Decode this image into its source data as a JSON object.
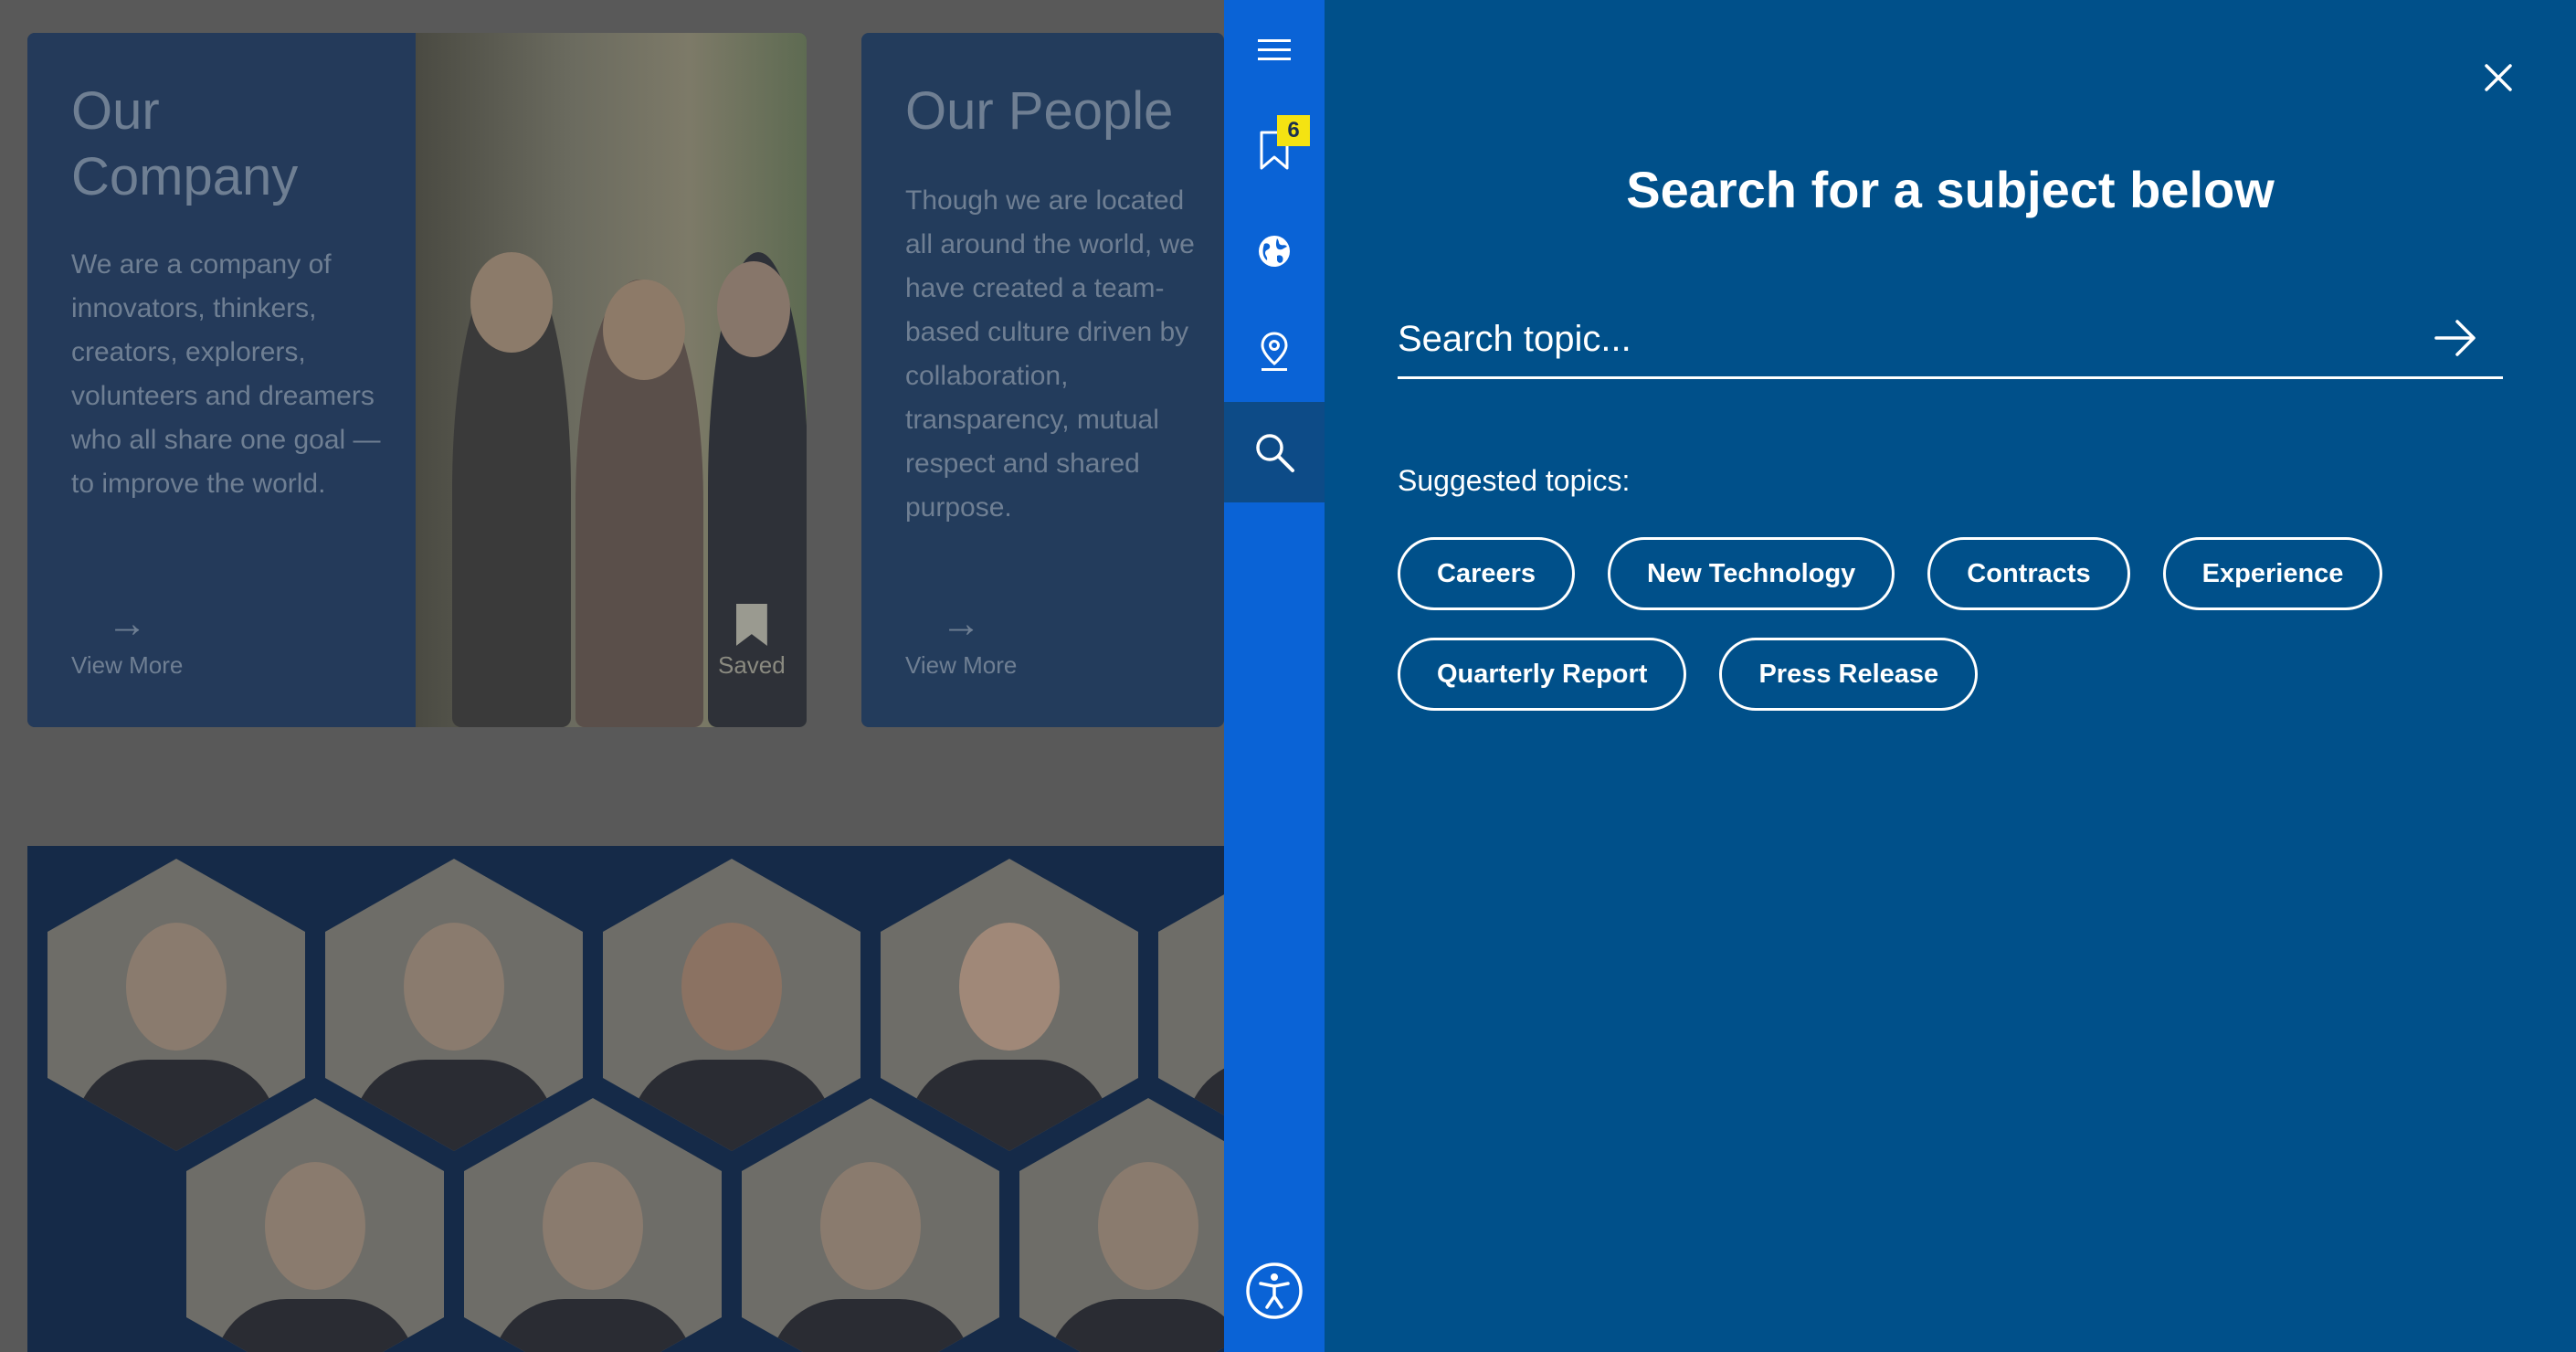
{
  "background": {
    "company_card": {
      "title": "Our Company",
      "text": "We are a company of innovators, thinkers, creators, explorers, volunteers and dreamers who all share one goal — to improve the world.",
      "link_label": "View More",
      "saved_label": "Saved"
    },
    "people_card": {
      "title": "Our People",
      "text": "Though we are located all around the world, we have created a team-based culture driven by collaboration, transparency, mutual respect and shared purpose.",
      "link_label": "View More"
    }
  },
  "sidebar": {
    "items": [
      {
        "icon": "hamburger-menu-icon"
      },
      {
        "icon": "bookmark-icon",
        "badge": "6"
      },
      {
        "icon": "globe-icon"
      },
      {
        "icon": "location-pin-icon"
      },
      {
        "icon": "search-icon",
        "active": true
      },
      {
        "icon": "accessibility-icon"
      }
    ],
    "color": "#0a63d6"
  },
  "search_panel": {
    "title": "Search for a subject below",
    "search_placeholder": "Search topic...",
    "search_value": "",
    "suggested_label": "Suggested topics:",
    "topics": [
      "Careers",
      "New Technology",
      "Contracts",
      "Experience",
      "Quarterly Report",
      "Press Release"
    ],
    "background_color": "#00508a"
  }
}
